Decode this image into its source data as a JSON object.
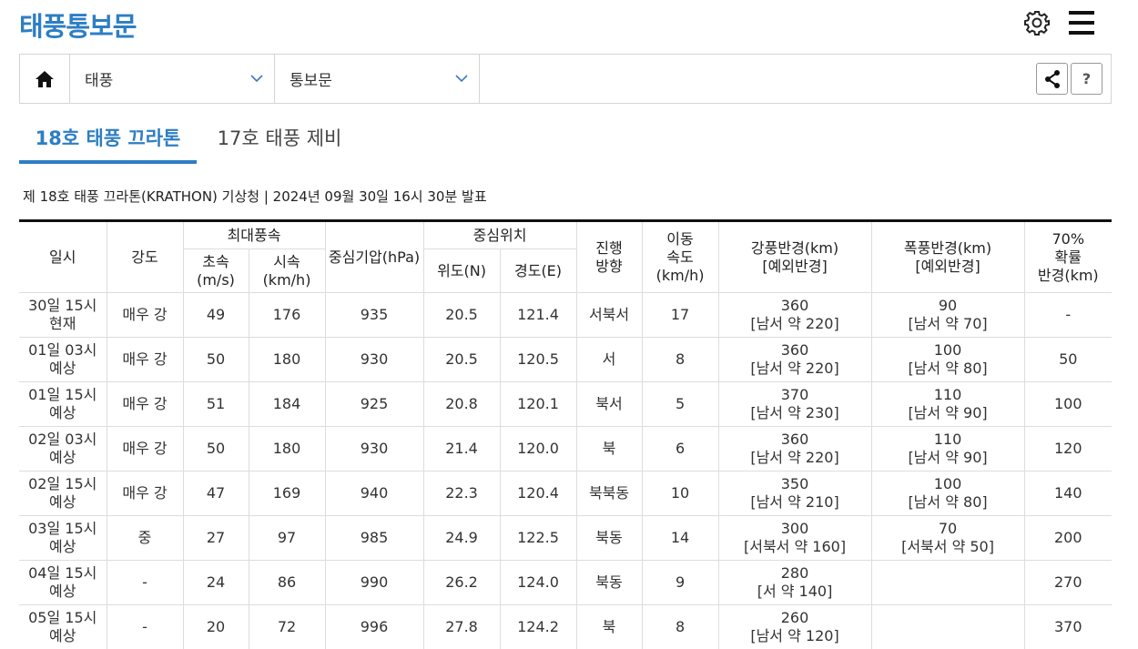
{
  "page_title": "태풍통보문",
  "nav": {
    "select1": "태풍",
    "select2": "통보문",
    "help": "?"
  },
  "tabs": [
    {
      "label": "18호 태풍 끄라톤"
    },
    {
      "label": "17호 태풍 제비"
    }
  ],
  "info_line": "제 18호 태풍 끄라톤(KRATHON) 기상청 | 2024년 09월 30일 16시 30분 발표",
  "table": {
    "headers": {
      "datetime": "일시",
      "intensity": "강도",
      "max_wind": "최대풍속",
      "wind_ms": "초속\n(m/s)",
      "wind_kmh": "시속\n(km/h)",
      "pressure": "중심기압(hPa)",
      "center": "중심위치",
      "lat": "위도(N)",
      "lon": "경도(E)",
      "direction": "진행\n방향",
      "speed": "이동\n속도\n(km/h)",
      "strong_radius": "강풍반경(km)\n[예외반경]",
      "storm_radius": "폭풍반경(km)\n[예외반경]",
      "prob70": "70%\n확률\n반경(km)"
    },
    "rows": [
      {
        "datetime": "30일 15시\n현재",
        "intensity": "매우 강",
        "ms": "49",
        "kmh": "176",
        "pressure": "935",
        "lat": "20.5",
        "lon": "121.4",
        "dir": "서북서",
        "speed": "17",
        "strong": "360\n[남서 약 220]",
        "storm": "90\n[남서 약 70]",
        "prob": "-"
      },
      {
        "datetime": "01일 03시\n예상",
        "intensity": "매우 강",
        "ms": "50",
        "kmh": "180",
        "pressure": "930",
        "lat": "20.5",
        "lon": "120.5",
        "dir": "서",
        "speed": "8",
        "strong": "360\n[남서 약 220]",
        "storm": "100\n[남서 약 80]",
        "prob": "50"
      },
      {
        "datetime": "01일 15시\n예상",
        "intensity": "매우 강",
        "ms": "51",
        "kmh": "184",
        "pressure": "925",
        "lat": "20.8",
        "lon": "120.1",
        "dir": "북서",
        "speed": "5",
        "strong": "370\n[남서 약 230]",
        "storm": "110\n[남서 약 90]",
        "prob": "100"
      },
      {
        "datetime": "02일 03시\n예상",
        "intensity": "매우 강",
        "ms": "50",
        "kmh": "180",
        "pressure": "930",
        "lat": "21.4",
        "lon": "120.0",
        "dir": "북",
        "speed": "6",
        "strong": "360\n[남서 약 220]",
        "storm": "110\n[남서 약 90]",
        "prob": "120"
      },
      {
        "datetime": "02일 15시\n예상",
        "intensity": "매우 강",
        "ms": "47",
        "kmh": "169",
        "pressure": "940",
        "lat": "22.3",
        "lon": "120.4",
        "dir": "북북동",
        "speed": "10",
        "strong": "350\n[남서 약 210]",
        "storm": "100\n[남서 약 80]",
        "prob": "140"
      },
      {
        "datetime": "03일 15시\n예상",
        "intensity": "중",
        "ms": "27",
        "kmh": "97",
        "pressure": "985",
        "lat": "24.9",
        "lon": "122.5",
        "dir": "북동",
        "speed": "14",
        "strong": "300\n[서북서 약 160]",
        "storm": "70\n[서북서 약 50]",
        "prob": "200"
      },
      {
        "datetime": "04일 15시\n예상",
        "intensity": "-",
        "ms": "24",
        "kmh": "86",
        "pressure": "990",
        "lat": "26.2",
        "lon": "124.0",
        "dir": "북동",
        "speed": "9",
        "strong": "280\n[서 약 140]",
        "storm": "",
        "prob": "270"
      },
      {
        "datetime": "05일 15시\n예상",
        "intensity": "-",
        "ms": "20",
        "kmh": "72",
        "pressure": "996",
        "lat": "27.8",
        "lon": "124.2",
        "dir": "북",
        "speed": "8",
        "strong": "260\n[남서 약 120]",
        "storm": "",
        "prob": "370"
      }
    ]
  }
}
